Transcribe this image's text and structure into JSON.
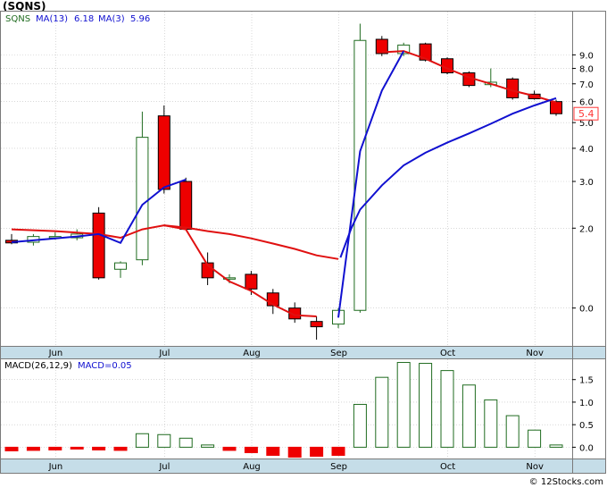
{
  "title": "(SQNS)",
  "watermark": "© 12Stocks.com",
  "colors": {
    "price_up_stroke": "#1f6b1f",
    "price_down_fill": "#ee0000",
    "ma13": "#1010d0",
    "ma3": "#e01010",
    "macd_bar": "#1f6b1f",
    "macd_neg_fill": "#ee0000",
    "axis_band": "#c5dde8",
    "grid": "#c0c0c0",
    "last_price_label": "#ff3333"
  },
  "chart_data": [
    {
      "type": "candlestick",
      "name": "price",
      "legend": {
        "ticker": "SQNS",
        "ma13_label": "MA(13)",
        "ma13_value": "6.18",
        "ma3_label": "MA(3)",
        "ma3_value": "5.96"
      },
      "last_price_label": "5.4",
      "y_ticks": [
        {
          "label": "9.0",
          "value": 9.0
        },
        {
          "label": "8.0",
          "value": 8.0
        },
        {
          "label": "7.0",
          "value": 7.0
        },
        {
          "label": "6.0",
          "value": 6.0
        },
        {
          "label": "5.0",
          "value": 5.0
        },
        {
          "label": "4.0",
          "value": 4.0
        },
        {
          "label": "3.0",
          "value": 3.0
        },
        {
          "label": "2.0",
          "value": 2.0
        },
        {
          "label": "0.0",
          "value": 1.0
        }
      ],
      "ylim": [
        0.72,
        13.2
      ],
      "log_scale": true,
      "x_ticks": [
        "Jun",
        "Jul",
        "Aug",
        "Sep",
        "Oct",
        "Nov"
      ],
      "x_tick_index": [
        1,
        6,
        10,
        14,
        19,
        23
      ],
      "candles": [
        {
          "o": 1.8,
          "h": 1.9,
          "l": 1.74,
          "c": 1.76
        },
        {
          "o": 1.77,
          "h": 1.9,
          "l": 1.72,
          "c": 1.86
        },
        {
          "o": 1.85,
          "h": 1.93,
          "l": 1.81,
          "c": 1.86
        },
        {
          "o": 1.84,
          "h": 1.98,
          "l": 1.8,
          "c": 1.9
        },
        {
          "o": 2.28,
          "h": 2.4,
          "l": 1.28,
          "c": 1.3
        },
        {
          "o": 1.4,
          "h": 1.5,
          "l": 1.3,
          "c": 1.48
        },
        {
          "o": 1.52,
          "h": 5.5,
          "l": 1.45,
          "c": 4.4
        },
        {
          "o": 5.3,
          "h": 5.8,
          "l": 2.7,
          "c": 2.8
        },
        {
          "o": 3.0,
          "h": 3.1,
          "l": 1.97,
          "c": 1.98
        },
        {
          "o": 1.48,
          "h": 1.62,
          "l": 1.22,
          "c": 1.3
        },
        {
          "o": 1.3,
          "h": 1.34,
          "l": 1.24,
          "c": 1.3
        },
        {
          "o": 1.34,
          "h": 1.38,
          "l": 1.12,
          "c": 1.18
        },
        {
          "o": 1.14,
          "h": 1.18,
          "l": 0.95,
          "c": 1.02
        },
        {
          "o": 1.0,
          "h": 1.05,
          "l": 0.88,
          "c": 0.91
        },
        {
          "o": 0.89,
          "h": 0.93,
          "l": 0.76,
          "c": 0.85
        },
        {
          "o": 0.87,
          "h": 1.0,
          "l": 0.84,
          "c": 0.98
        },
        {
          "o": 0.98,
          "h": 11.8,
          "l": 0.96,
          "c": 10.2
        },
        {
          "o": 10.3,
          "h": 10.6,
          "l": 8.9,
          "c": 9.1
        },
        {
          "o": 9.1,
          "h": 10.0,
          "l": 8.9,
          "c": 9.8
        },
        {
          "o": 9.9,
          "h": 10.0,
          "l": 8.5,
          "c": 8.6
        },
        {
          "o": 8.7,
          "h": 8.8,
          "l": 7.6,
          "c": 7.7
        },
        {
          "o": 7.7,
          "h": 7.8,
          "l": 6.8,
          "c": 6.9
        },
        {
          "o": 6.95,
          "h": 8.0,
          "l": 6.8,
          "c": 7.1
        },
        {
          "o": 7.3,
          "h": 7.4,
          "l": 6.1,
          "c": 6.2
        },
        {
          "o": 6.4,
          "h": 6.6,
          "l": 6.1,
          "c": 6.15
        },
        {
          "o": 6.0,
          "h": 6.1,
          "l": 5.3,
          "c": 5.4
        }
      ],
      "ma13_values": [
        1.77,
        1.79,
        1.82,
        1.85,
        1.71,
        2.4,
        2.75,
        3.05,
        null,
        null,
        null,
        null,
        null,
        null,
        null,
        1.0,
        3.9,
        6.6,
        9.3,
        null,
        null,
        null,
        null,
        null,
        null,
        6.18
      ],
      "ma3_values": [
        1.98,
        1.94,
        1.91,
        1.88,
        1.83,
        1.78,
        1.98,
        2.05,
        2.02,
        1.94,
        1.86,
        1.78,
        1.7,
        1.6,
        1.52,
        1.92,
        2.65,
        3.4,
        4.0,
        4.5,
        5.0,
        5.5,
        5.8,
        6.18
      ],
      "ma3_index_start": 0,
      "ma3_path": [
        [
          0,
          1.98
        ],
        [
          4,
          1.83
        ],
        [
          5,
          1.8
        ],
        [
          6,
          2.0
        ],
        [
          7,
          2.05
        ],
        [
          8,
          2.0
        ],
        [
          9,
          1.45
        ],
        [
          10,
          1.26
        ],
        [
          11,
          1.16
        ],
        [
          12,
          1.03
        ],
        [
          13,
          0.94
        ],
        [
          14,
          0.94
        ],
        [
          15,
          0.94
        ],
        [
          16,
          1.38
        ],
        [
          17,
          2.05
        ],
        [
          18,
          4.3
        ],
        [
          19,
          5.25
        ],
        [
          20,
          5.8
        ],
        [
          21,
          6.3
        ],
        [
          22,
          6.9
        ],
        [
          23,
          7.35
        ],
        [
          24,
          7.6
        ],
        [
          25,
          7.85
        ],
        [
          26,
          8.2
        ],
        [
          27,
          8.6
        ],
        [
          28,
          8.9
        ],
        [
          29,
          9.2
        ],
        [
          30,
          8.7
        ],
        [
          31,
          8.3
        ],
        [
          32,
          7.8
        ],
        [
          33,
          7.3
        ],
        [
          34,
          6.9
        ],
        [
          35,
          6.4
        ],
        [
          36,
          6.15
        ]
      ]
    },
    {
      "type": "bar",
      "name": "macd",
      "legend": {
        "label": "MACD(26,12,9)",
        "value_label": "MACD=0.05"
      },
      "y_ticks": [
        {
          "label": "1.5",
          "value": 1.5
        },
        {
          "label": "1.0",
          "value": 1.0
        },
        {
          "label": "0.5",
          "value": 0.5
        },
        {
          "label": "0.0",
          "value": 0.0
        }
      ],
      "ylim": [
        -0.25,
        1.95
      ],
      "x_ticks": [
        "Jun",
        "Jul",
        "Aug",
        "Sep",
        "Oct",
        "Nov"
      ],
      "values": [
        -0.08,
        -0.07,
        -0.06,
        -0.04,
        -0.06,
        -0.07,
        0.3,
        0.28,
        0.2,
        0.05,
        -0.07,
        -0.12,
        -0.18,
        -0.22,
        -0.2,
        -0.18,
        0.95,
        1.55,
        1.88,
        1.86,
        1.7,
        1.38,
        1.05,
        0.7,
        0.38,
        0.05
      ]
    }
  ]
}
